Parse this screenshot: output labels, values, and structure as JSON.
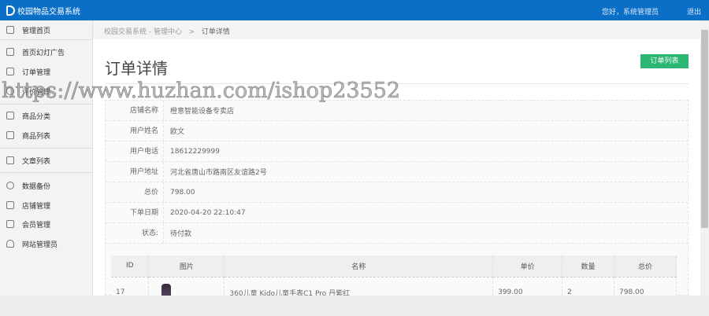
{
  "header": {
    "logo": "校园物品交易系统",
    "greeting": "您好，系统管理员",
    "logout": "退出"
  },
  "sidebar": {
    "items": [
      {
        "label": "管理首页",
        "icon": "home-icon"
      },
      {
        "label": "首页幻灯广告",
        "icon": "image-icon"
      },
      {
        "label": "订单管理",
        "icon": "list-icon"
      },
      {
        "label": "评价管理",
        "icon": "share-icon"
      },
      {
        "label": "商品分类",
        "icon": "grid-icon"
      },
      {
        "label": "商品列表",
        "icon": "apps-icon"
      },
      {
        "label": "文章列表",
        "icon": "file-icon"
      },
      {
        "label": "数据备份",
        "icon": "refresh-icon"
      },
      {
        "label": "店铺管理",
        "icon": "store-icon"
      },
      {
        "label": "会员管理",
        "icon": "book-icon"
      },
      {
        "label": "网站管理员",
        "icon": "user-icon"
      }
    ]
  },
  "breadcrumb": {
    "root": "校园交易系统 - 管理中心",
    "sep": ">",
    "current": "订单详情"
  },
  "page": {
    "title": "订单详情",
    "list_button": "订单列表"
  },
  "info": [
    {
      "label": "店铺名称",
      "value": "橙意智能设备专卖店"
    },
    {
      "label": "用户姓名",
      "value": "欧文"
    },
    {
      "label": "用户电话",
      "value": "18612229999"
    },
    {
      "label": "用户地址",
      "value": "河北省唐山市路南区友谊路2号"
    },
    {
      "label": "总价",
      "value": "798.00"
    },
    {
      "label": "下单日期",
      "value": "2020-04-20 22:10:47"
    },
    {
      "label": "状态:",
      "value": "待付款"
    }
  ],
  "products": {
    "headers": [
      "ID",
      "图片",
      "名称",
      "单价",
      "数量",
      "总价"
    ],
    "rows": [
      {
        "id": "17",
        "name": "360儿童 Kido儿童手表C1 Pro 丹紫红",
        "price": "399.00",
        "qty": "2",
        "total": "798.00"
      }
    ]
  },
  "watermark": "https://www.huzhan.com/ishop23552"
}
